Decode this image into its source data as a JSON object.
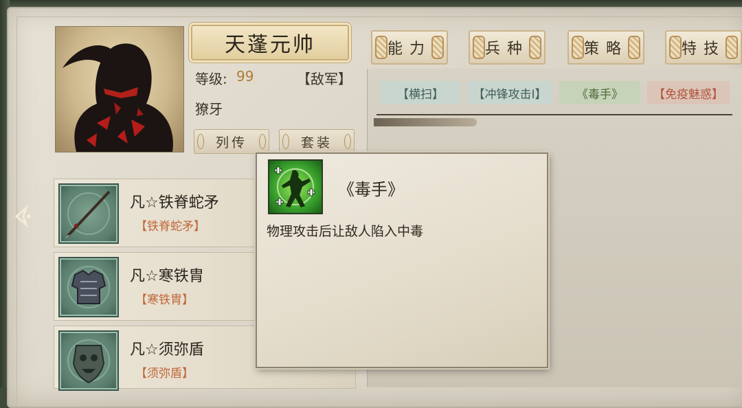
{
  "character": {
    "name": "天蓬元帅",
    "level_label": "等级:",
    "level_value": "99",
    "faction": "【敌军】",
    "subtitle": "獠牙"
  },
  "buttons": {
    "biography": "列传",
    "set": "套装"
  },
  "tabs": [
    {
      "label": "能力"
    },
    {
      "label": "兵种"
    },
    {
      "label": "策略"
    },
    {
      "label": "特技"
    }
  ],
  "skills": [
    {
      "label": "【横扫】",
      "color": "#3f5f58",
      "bg": "#c9d6cf"
    },
    {
      "label": "【冲锋攻击Ⅰ】",
      "color": "#3f5f58",
      "bg": "#c9d6cf"
    },
    {
      "label": "《毒手》",
      "color": "#4d6a3a",
      "bg": "#c7d3b8"
    },
    {
      "label": "【免疫魅惑】",
      "color": "#b2543c",
      "bg": "#dbc5b8"
    }
  ],
  "equipment": [
    {
      "name": "凡☆铁脊蛇矛",
      "sub": "【铁脊蛇矛】",
      "icon": "spear-icon"
    },
    {
      "name": "凡☆寒铁胄",
      "sub": "【寒铁胄】",
      "icon": "armor-icon"
    },
    {
      "name": "凡☆须弥盾",
      "sub": "【须弥盾】",
      "icon": "shield-icon"
    }
  ],
  "popup": {
    "title": "《毒手》",
    "description": "物理攻击后让敌人陷入中毒",
    "icon": "poison-hand-icon"
  },
  "colors": {
    "level": "#b07a35",
    "equip_sub": "#c0683a"
  }
}
